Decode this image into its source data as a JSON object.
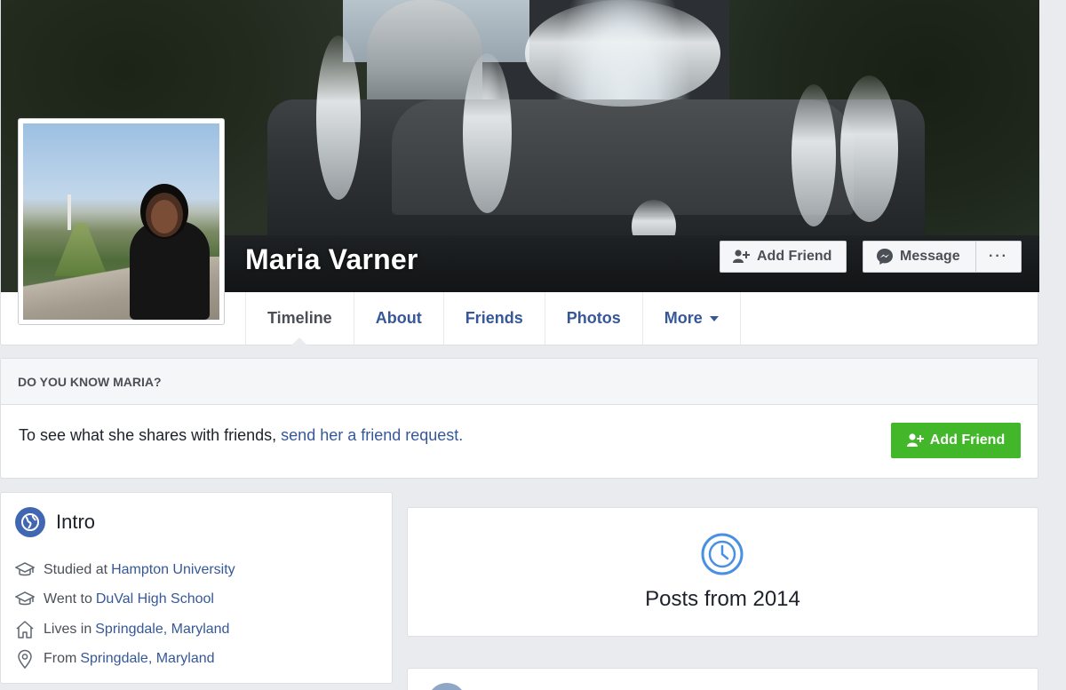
{
  "profile": {
    "name": "Maria Varner"
  },
  "cover_actions": {
    "add_friend": "Add Friend",
    "message": "Message",
    "more": "···"
  },
  "tabs": [
    {
      "label": "Timeline",
      "active": true
    },
    {
      "label": "About"
    },
    {
      "label": "Friends"
    },
    {
      "label": "Photos"
    },
    {
      "label": "More"
    }
  ],
  "know_card": {
    "heading": "DO YOU KNOW MARIA?",
    "text": "To see what she shares with friends,",
    "link": "send her a friend request.",
    "button": "Add Friend"
  },
  "intro": {
    "title": "Intro",
    "items": [
      {
        "icon": "graduation-cap-icon",
        "prefix": "Studied at",
        "link": "Hampton University"
      },
      {
        "icon": "graduation-cap-icon",
        "prefix": "Went to",
        "link": "DuVal High School"
      },
      {
        "icon": "home-icon",
        "prefix": "Lives in",
        "link": "Springdale, Maryland"
      },
      {
        "icon": "location-pin-icon",
        "prefix": "From",
        "link": "Springdale, Maryland"
      }
    ]
  },
  "posts": {
    "title": "Posts from 2014",
    "icon": "clock-icon"
  },
  "colors": {
    "link": "#365899",
    "green_button": "#42b72a",
    "background": "#e9ebee"
  }
}
